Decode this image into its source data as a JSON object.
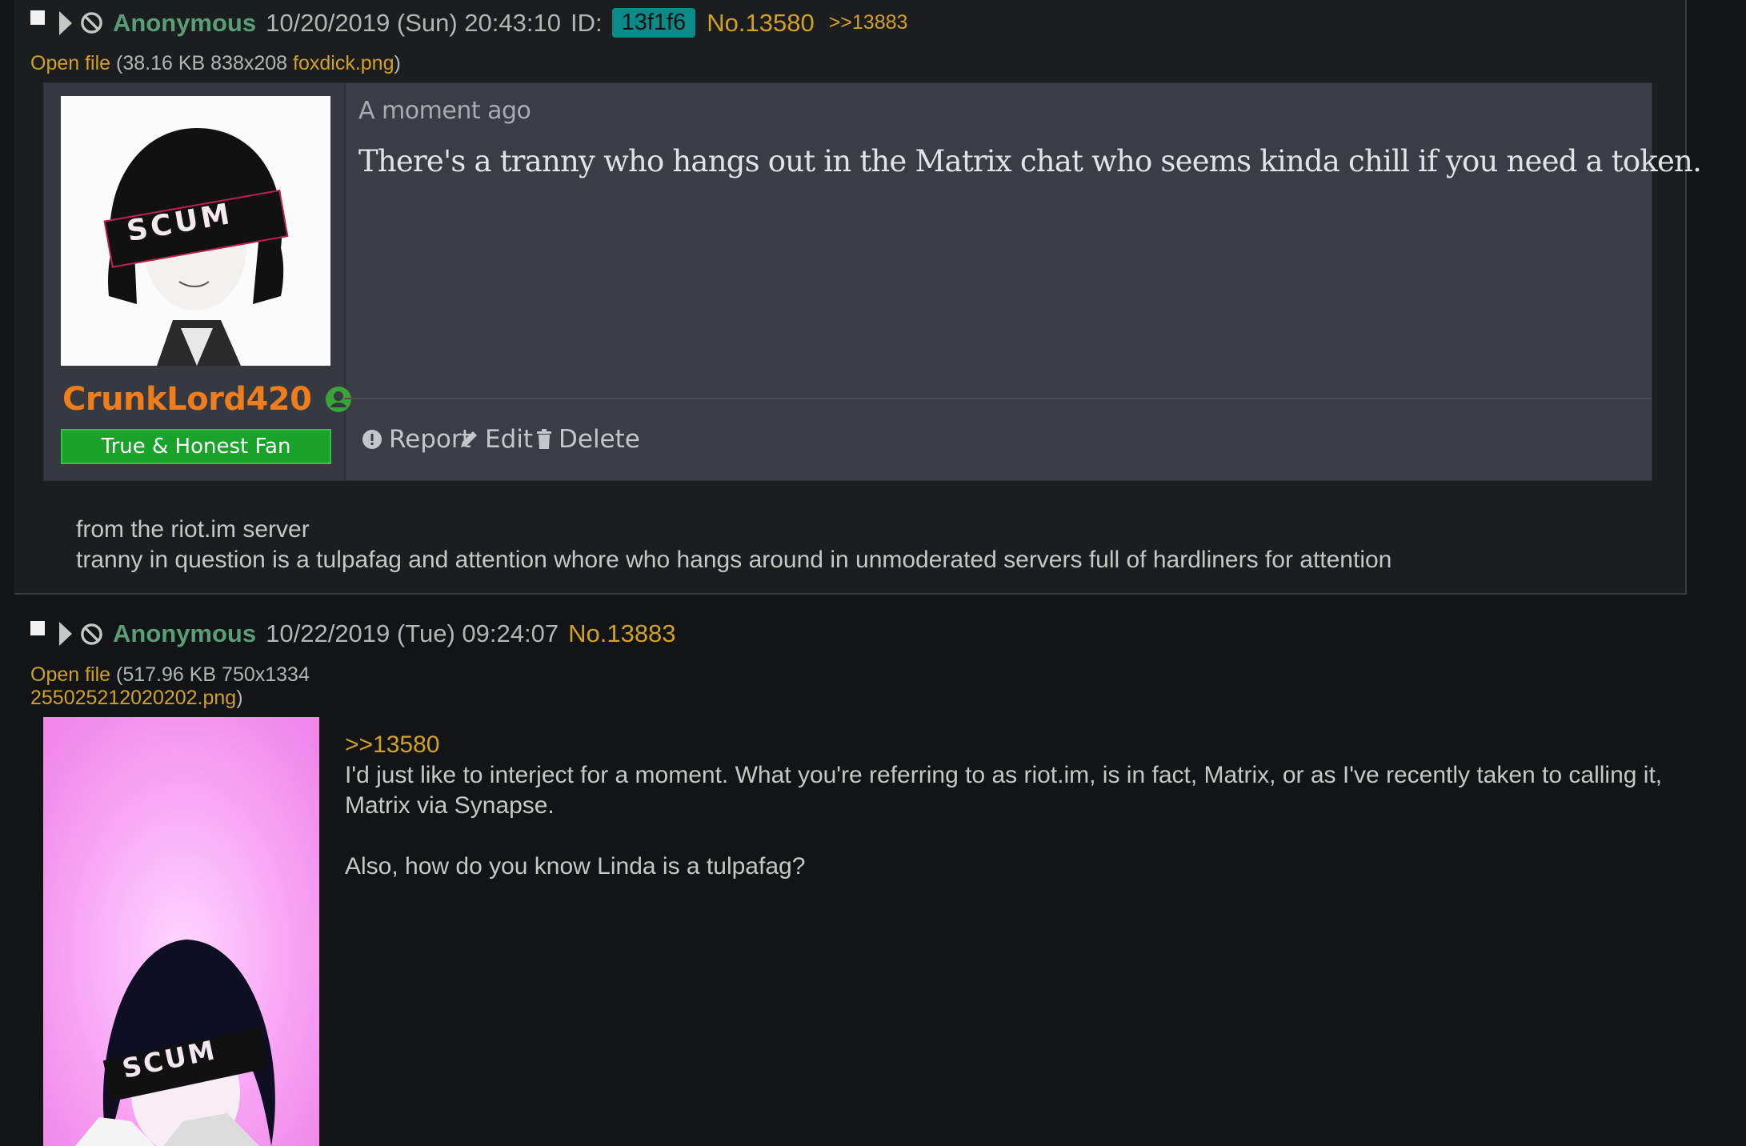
{
  "post1": {
    "name": "Anonymous",
    "date": "10/20/2019 (Sun) 20:43:10",
    "id_label": "ID:",
    "id": "13f1f6",
    "number": "No.13580",
    "backlink": ">>13883",
    "file": {
      "open_label": "Open file",
      "meta": " (38.16 KB 838x208 ",
      "filename": "foxdick.png",
      "close": ")"
    },
    "embed": {
      "avatar_badge": "SCUM",
      "username": "CrunkLord420",
      "role": "True & Honest Fan",
      "time_ago": "A moment ago",
      "message": "There's a tranny who hangs out in the Matrix chat who seems kinda chill if you need a token.",
      "actions": {
        "report": "Report",
        "edit": "Edit",
        "delete": "Delete"
      }
    },
    "body": [
      "from the riot.im server",
      "tranny in question is a tulpafag and attention whore who hangs around in unmoderated servers full of hardliners for attention"
    ]
  },
  "post2": {
    "name": "Anonymous",
    "date": "10/22/2019 (Tue) 09:24:07",
    "number": "No.13883",
    "file": {
      "open_label": "Open file",
      "meta": " (517.96 KB 750x1334",
      "filename": "255025212020202.png",
      "close": ")"
    },
    "thumb_badge": "SCUM",
    "quote": ">>13580",
    "body": [
      "I'd just like to interject for a moment. What you're referring to as riot.im, is in fact, Matrix, or as I've recently taken to calling it, Matrix via Synapse.",
      "Also, how do you know Linda is a tulpafag?"
    ]
  },
  "colors": {
    "page_bg": "#131416",
    "post_bg": "#1c1d1f",
    "name": "#5a9e78",
    "link": "#d1a126",
    "id_badge": "#0b8a87",
    "username": "#ef7d1c",
    "role_badge": "#1aa32b"
  },
  "icons": [
    "checkbox-icon",
    "expand-triangle-icon",
    "hide-post-icon",
    "user-status-icon",
    "report-icon",
    "edit-icon",
    "delete-icon"
  ]
}
